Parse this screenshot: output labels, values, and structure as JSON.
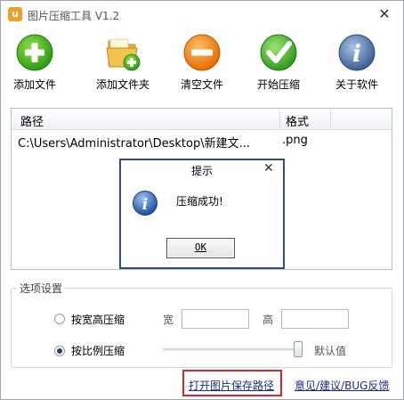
{
  "window": {
    "title": "图片压缩工具 V1.2",
    "app_icon_letter": "u"
  },
  "toolbar": {
    "items": [
      {
        "label": "添加文件",
        "icon": "add-icon"
      },
      {
        "label": "添加文件夹",
        "icon": "folder-add-icon"
      },
      {
        "label": "清空文件",
        "icon": "minus-icon"
      },
      {
        "label": "开始压缩",
        "icon": "check-icon"
      },
      {
        "label": "关于软件",
        "icon": "info-icon"
      }
    ]
  },
  "file_list": {
    "columns": [
      "路径",
      "格式"
    ],
    "rows": [
      {
        "path": "C:\\Users\\Administrator\\Desktop\\新建文...",
        "format": ".png"
      }
    ]
  },
  "options": {
    "title": "选项设置",
    "by_size_label": "按宽高压缩",
    "width_label": "宽",
    "height_label": "高",
    "width_value": "",
    "height_value": "",
    "by_ratio_label": "按比例压缩",
    "slider_value_label": "默认值",
    "selected": "by_ratio",
    "slider_level": 1.0
  },
  "footer": {
    "open_path_link": "打开图片保存路径",
    "feedback_link": "意见/建议/BUG反馈"
  },
  "dialog": {
    "title": "提示",
    "message": "压缩成功!",
    "ok_label": "OK"
  },
  "colors": {
    "accent_border": "#2e4f86",
    "highlight": "#e0242b",
    "link": "#1a2b8c"
  }
}
